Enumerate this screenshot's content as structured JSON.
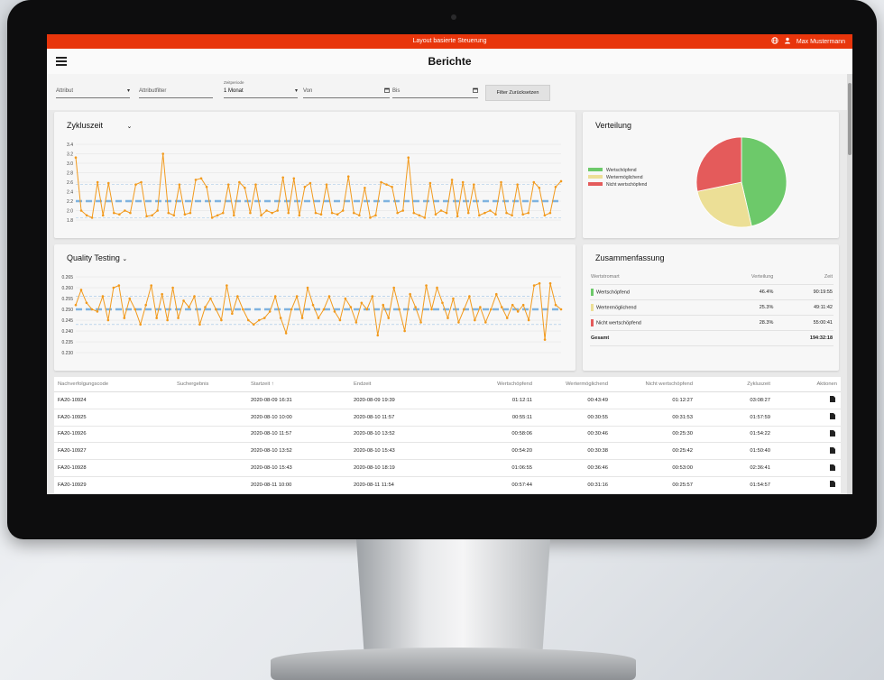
{
  "app": {
    "topbar_title": "Layout basierte Steuerung",
    "user": "Max Mustermann",
    "page_title": "Berichte"
  },
  "filters": {
    "attribut": "Attribut",
    "attributfilter": "Attributfilter",
    "zeitperiode_label": "Zeitperiode",
    "zeitperiode_value": "1 Monat",
    "von": "Von",
    "bis": "Bis",
    "reset": "Filter Zurücksetzen"
  },
  "colors": {
    "accent": "#e8350b",
    "series": "#f29a1d",
    "mean": "#7fb3e0",
    "green": "#6dc96a",
    "yellow": "#ecdf96",
    "red": "#e45b5b"
  },
  "zyklus": {
    "title": "Zykluszeit"
  },
  "quality": {
    "title": "Quality Testing"
  },
  "verteilung": {
    "title": "Verteilung"
  },
  "zusammenfassung": {
    "title": "Zusammenfassung",
    "headers": [
      "Wertstromart",
      "Verteilung",
      "Zeit"
    ],
    "rows": [
      {
        "name": "Wertschöpfend",
        "pct": "46.4%",
        "time": "90:19:55"
      },
      {
        "name": "Wertermöglichend",
        "pct": "25.3%",
        "time": "49:11:42"
      },
      {
        "name": "Nicht wertschöpfend",
        "pct": "28.3%",
        "time": "55:00:41"
      }
    ],
    "total_label": "Gesamt",
    "total": "194:32:18"
  },
  "table": {
    "headers": [
      "Nachverfolgungscode",
      "Suchergebnis",
      "Startzeit ↑",
      "Endzeit",
      "Wertschöpfend",
      "Wertermöglichend",
      "Nicht wertschöpfend",
      "Zykluszeit",
      "Aktionen"
    ],
    "rows": [
      [
        "FA20-10924",
        "",
        "2020-08-09 16:31",
        "2020-08-09 19:39",
        "01:12:11",
        "00:43:49",
        "01:12:27",
        "03:08:27"
      ],
      [
        "FA20-10925",
        "",
        "2020-08-10 10:00",
        "2020-08-10 11:57",
        "00:55:11",
        "00:30:55",
        "00:31:53",
        "01:57:59"
      ],
      [
        "FA20-10926",
        "",
        "2020-08-10 11:57",
        "2020-08-10 13:52",
        "00:58:06",
        "00:30:46",
        "00:25:30",
        "01:54:22"
      ],
      [
        "FA20-10927",
        "",
        "2020-08-10 13:52",
        "2020-08-10 15:43",
        "00:54:20",
        "00:30:38",
        "00:25:42",
        "01:50:40"
      ],
      [
        "FA20-10928",
        "",
        "2020-08-10 15:43",
        "2020-08-10 18:19",
        "01:06:55",
        "00:36:46",
        "00:53:00",
        "02:36:41"
      ],
      [
        "FA20-10929",
        "",
        "2020-08-11 10:00",
        "2020-08-11 11:54",
        "00:57:44",
        "00:31:16",
        "00:25:57",
        "01:54:57"
      ],
      [
        "FA20-10930",
        "",
        "2020-08-11 11:54",
        "2020-08-11 14:29",
        "01:08:45",
        "00:36:22",
        "00:49:00",
        "02:34:07"
      ]
    ]
  },
  "chart_data": [
    {
      "type": "line",
      "title": "Zykluszeit",
      "ylim": [
        1.8,
        3.4
      ],
      "yticks": [
        "3.4",
        "3.2",
        "3.0",
        "2.8",
        "2.6",
        "2.4",
        "2.2",
        "2.0",
        "1.8"
      ],
      "mean": 2.2,
      "bounds": [
        2.55,
        1.85
      ],
      "values": [
        3.12,
        2.0,
        1.9,
        1.85,
        2.6,
        1.9,
        2.58,
        1.95,
        1.92,
        2.0,
        1.95,
        2.55,
        2.6,
        1.88,
        1.9,
        2.0,
        3.2,
        1.95,
        1.9,
        2.55,
        1.92,
        1.95,
        2.65,
        2.68,
        2.5,
        1.85,
        1.9,
        1.95,
        2.55,
        1.9,
        2.6,
        2.48,
        1.95,
        2.55,
        1.9,
        2.0,
        1.95,
        2.0,
        2.7,
        1.95,
        2.68,
        1.9,
        2.5,
        2.58,
        1.95,
        1.92,
        2.55,
        1.95,
        1.92,
        2.0,
        2.72,
        1.95,
        1.9,
        2.48,
        1.85,
        1.9,
        2.6,
        2.55,
        2.5,
        1.95,
        2.0,
        3.12,
        1.95,
        1.9,
        1.85,
        2.58,
        1.92,
        2.0,
        1.95,
        2.65,
        1.88,
        2.6,
        1.95,
        2.55,
        1.9,
        1.95,
        2.0,
        1.92,
        2.6,
        1.95,
        1.9,
        2.55,
        1.92,
        1.95,
        2.6,
        2.48,
        1.9,
        1.95,
        2.5,
        2.62
      ]
    },
    {
      "type": "line",
      "title": "Quality Testing",
      "ylim": [
        0.23,
        0.265
      ],
      "yticks": [
        "0.265",
        "0.260",
        "0.255",
        "0.250",
        "0.245",
        "0.240",
        "0.235",
        "0.230"
      ],
      "mean": 0.25,
      "bounds": [
        0.256,
        0.243
      ],
      "values": [
        0.252,
        0.259,
        0.253,
        0.25,
        0.249,
        0.256,
        0.245,
        0.26,
        0.261,
        0.246,
        0.255,
        0.25,
        0.243,
        0.252,
        0.261,
        0.246,
        0.257,
        0.245,
        0.26,
        0.246,
        0.254,
        0.251,
        0.256,
        0.243,
        0.251,
        0.255,
        0.25,
        0.245,
        0.261,
        0.248,
        0.256,
        0.25,
        0.245,
        0.243,
        0.245,
        0.246,
        0.249,
        0.256,
        0.246,
        0.239,
        0.25,
        0.256,
        0.246,
        0.26,
        0.252,
        0.246,
        0.25,
        0.256,
        0.249,
        0.245,
        0.255,
        0.251,
        0.244,
        0.253,
        0.25,
        0.256,
        0.238,
        0.252,
        0.246,
        0.26,
        0.25,
        0.24,
        0.257,
        0.251,
        0.244,
        0.261,
        0.25,
        0.26,
        0.253,
        0.246,
        0.255,
        0.244,
        0.25,
        0.256,
        0.245,
        0.251,
        0.244,
        0.25,
        0.257,
        0.251,
        0.246,
        0.252,
        0.249,
        0.252,
        0.245,
        0.261,
        0.262,
        0.236,
        0.262,
        0.252,
        0.25
      ]
    },
    {
      "type": "pie",
      "title": "Verteilung",
      "categories": [
        "Wertschöpfend",
        "Wertermöglichend",
        "Nicht wertschöpfend"
      ],
      "values": [
        46.4,
        25.3,
        28.3
      ],
      "legend": "left"
    }
  ]
}
